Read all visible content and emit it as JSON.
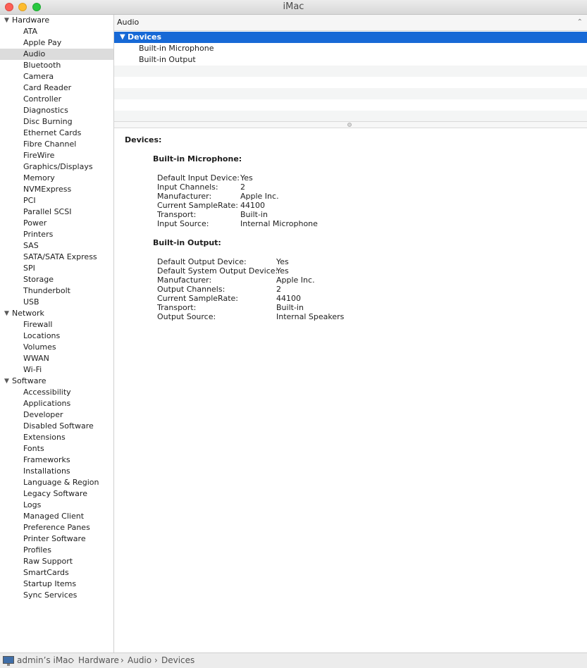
{
  "window": {
    "title": "iMac"
  },
  "sidebar": {
    "groups": [
      {
        "label": "Hardware",
        "items": [
          "ATA",
          "Apple Pay",
          "Audio",
          "Bluetooth",
          "Camera",
          "Card Reader",
          "Controller",
          "Diagnostics",
          "Disc Burning",
          "Ethernet Cards",
          "Fibre Channel",
          "FireWire",
          "Graphics/Displays",
          "Memory",
          "NVMExpress",
          "PCI",
          "Parallel SCSI",
          "Power",
          "Printers",
          "SAS",
          "SATA/SATA Express",
          "SPI",
          "Storage",
          "Thunderbolt",
          "USB"
        ]
      },
      {
        "label": "Network",
        "items": [
          "Firewall",
          "Locations",
          "Volumes",
          "WWAN",
          "Wi-Fi"
        ]
      },
      {
        "label": "Software",
        "items": [
          "Accessibility",
          "Applications",
          "Developer",
          "Disabled Software",
          "Extensions",
          "Fonts",
          "Frameworks",
          "Installations",
          "Language & Region",
          "Legacy Software",
          "Logs",
          "Managed Client",
          "Preference Panes",
          "Printer Software",
          "Profiles",
          "Raw Support",
          "SmartCards",
          "Startup Items",
          "Sync Services"
        ]
      }
    ],
    "selected": "Audio"
  },
  "main": {
    "header": "Audio",
    "tree": {
      "group": "Devices",
      "items": [
        "Built-in Microphone",
        "Built-in Output"
      ]
    },
    "detail": {
      "title": "Devices:",
      "sections": [
        {
          "name": "Built-in Microphone:",
          "rows": [
            {
              "key": "Default Input Device:",
              "value": "Yes"
            },
            {
              "key": "Input Channels:",
              "value": "2"
            },
            {
              "key": "Manufacturer:",
              "value": "Apple Inc."
            },
            {
              "key": "Current SampleRate:",
              "value": "44100"
            },
            {
              "key": "Transport:",
              "value": "Built-in"
            },
            {
              "key": "Input Source:",
              "value": "Internal Microphone"
            }
          ]
        },
        {
          "name": "Built-in Output:",
          "rows": [
            {
              "key": "Default Output Device:",
              "value": "Yes"
            },
            {
              "key": "Default System Output Device:",
              "value": "Yes"
            },
            {
              "key": "Manufacturer:",
              "value": "Apple Inc."
            },
            {
              "key": "Output Channels:",
              "value": "2"
            },
            {
              "key": "Current SampleRate:",
              "value": "44100"
            },
            {
              "key": "Transport:",
              "value": "Built-in"
            },
            {
              "key": "Output Source:",
              "value": "Internal Speakers"
            }
          ]
        }
      ]
    }
  },
  "statusbar": {
    "icon": "imac-icon",
    "crumbs": [
      "admin’s iMac",
      "Hardware",
      "Audio",
      "Devices"
    ],
    "separator": "›"
  }
}
